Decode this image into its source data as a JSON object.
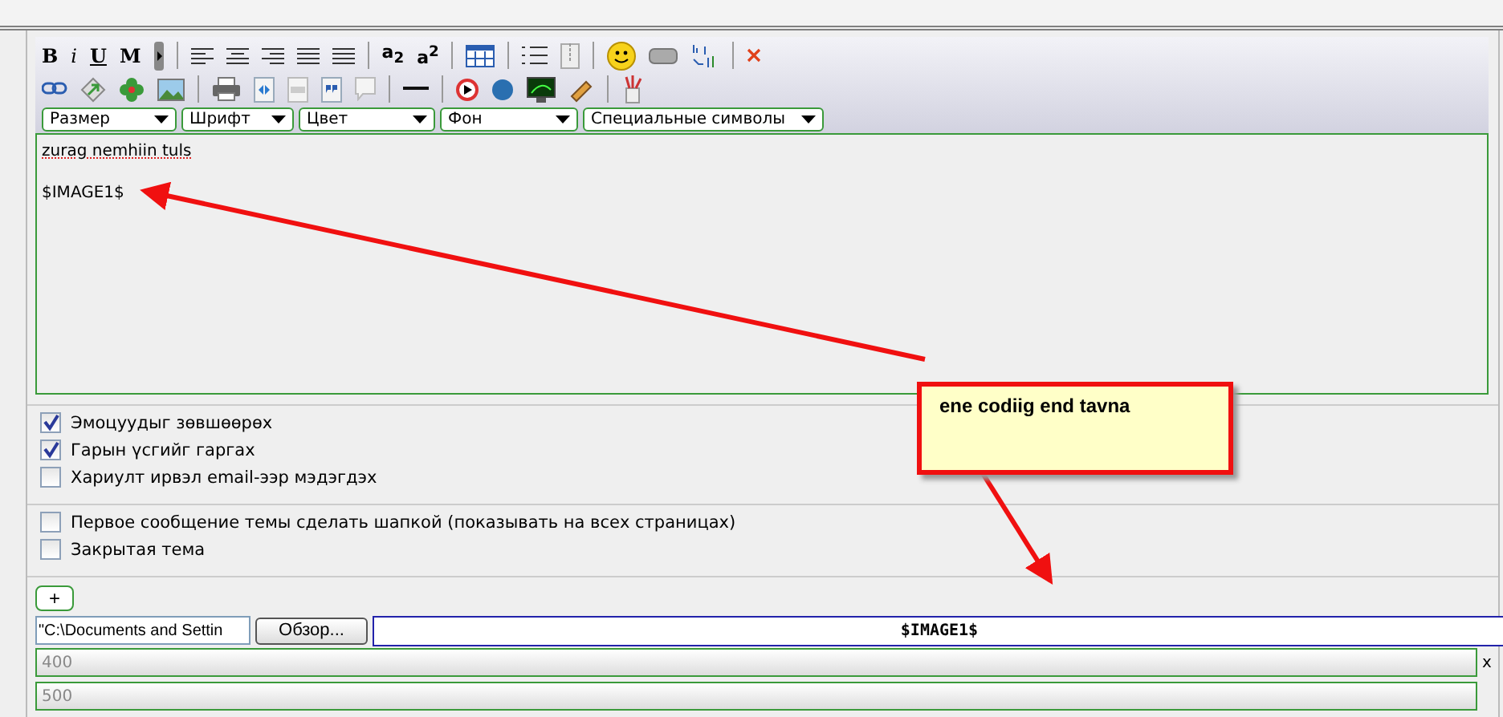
{
  "toolbar": {
    "format_buttons": [
      "B",
      "i",
      "U",
      "M"
    ],
    "script_buttons": [
      "a$_{2}$",
      "a$^{2}$"
    ],
    "dropdowns": [
      {
        "label": "Размер"
      },
      {
        "label": "Шрифт"
      },
      {
        "label": "Цвет"
      },
      {
        "label": "Фон"
      },
      {
        "label": "Специальные символы"
      }
    ]
  },
  "editor": {
    "lines": [
      "zurag nemhiin tuls",
      "$IMAGE1$"
    ]
  },
  "options": [
    {
      "label": "Эмоцуудыг зөвшөөрөх",
      "checked": true
    },
    {
      "label": "Гарын үсгийг гаргах",
      "checked": true
    },
    {
      "label": "Хариулт ирвэл email-ээр мэдэгдэх",
      "checked": false
    }
  ],
  "topic_options": [
    {
      "label": "Первое сообщение темы сделать шапкой (показывать на всех страницах)",
      "checked": false
    },
    {
      "label": "Закрытая тема",
      "checked": false
    }
  ],
  "attach": {
    "add_button": "+",
    "file_path": "\"C:\\Documents and Settin",
    "browse_button": "Обзор...",
    "code_field": "$IMAGE1$"
  },
  "size_fields": [
    {
      "placeholder": "400",
      "suffix": "x"
    },
    {
      "placeholder": "500"
    }
  ],
  "callout": {
    "text": "ene codiig end tavna"
  }
}
